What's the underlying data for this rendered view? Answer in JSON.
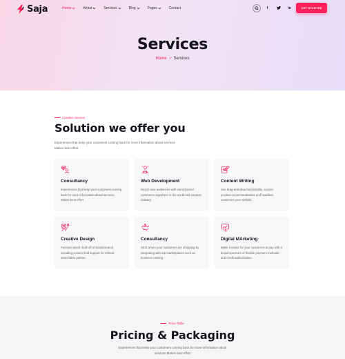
{
  "brand": {
    "name": "Saja",
    "accent": "#ff1f5a"
  },
  "nav": {
    "items": [
      {
        "label": "Home",
        "has_caret": true,
        "active": true
      },
      {
        "label": "About",
        "has_caret": true,
        "active": false
      },
      {
        "label": "Services",
        "has_caret": true,
        "active": false
      },
      {
        "label": "Blog",
        "has_caret": true,
        "active": false
      },
      {
        "label": "Pages",
        "has_caret": true,
        "active": false
      },
      {
        "label": "Contact",
        "has_caret": false,
        "active": false
      }
    ],
    "search_icon": "search-icon",
    "socials": [
      {
        "icon": "facebook-icon",
        "glyph": "f"
      },
      {
        "icon": "twitter-icon",
        "glyph": ""
      },
      {
        "icon": "linkedin-icon",
        "glyph": "in"
      }
    ],
    "cta_label": "GET STARTED"
  },
  "hero": {
    "title": "Services",
    "breadcrumb": {
      "home": "Home",
      "separator": "›",
      "current": "Services"
    }
  },
  "services_section": {
    "eyebrow": "Creative Service",
    "title": "Solution we offer you",
    "description": "Experiences that keep your customers coming back for more information about services Makes best effort",
    "cards": [
      {
        "icon": "consultancy-icon",
        "title": "Consultancy",
        "text": "Experiences that keep your customers coming back for more information about services Makes best effort"
      },
      {
        "icon": "web-development-icon",
        "title": "Web Development",
        "text": "Reach new audiences with omnichannel commerce anywhere in the world and surpass industry"
      },
      {
        "icon": "content-writing-icon",
        "title": "Content Writing",
        "text": "Use drag-and-drop functionality, custom product recommendations and headless customize your website."
      },
      {
        "icon": "creative-design-icon",
        "title": "Creative Design",
        "text": "Faceted search built off of Elasticsearch, including custom field support for refined searchable partner."
      },
      {
        "icon": "consultancy-handshake-icon",
        "title": "Consultancy",
        "text": "SEO where your customers are shopping by integrating with top marketplaces such as business ranking."
      },
      {
        "icon": "digital-marketing-icon",
        "title": "Digital MArketing",
        "text": "Make it easier for your customers to pay with a broad spectrum of flexible payment methods and credit authorization."
      }
    ]
  },
  "pricing_section": {
    "eyebrow": "Price Table",
    "title": "Pricing & Packaging",
    "description": "Experiences that keep your customers coming back for more information about services Makes best effort"
  }
}
